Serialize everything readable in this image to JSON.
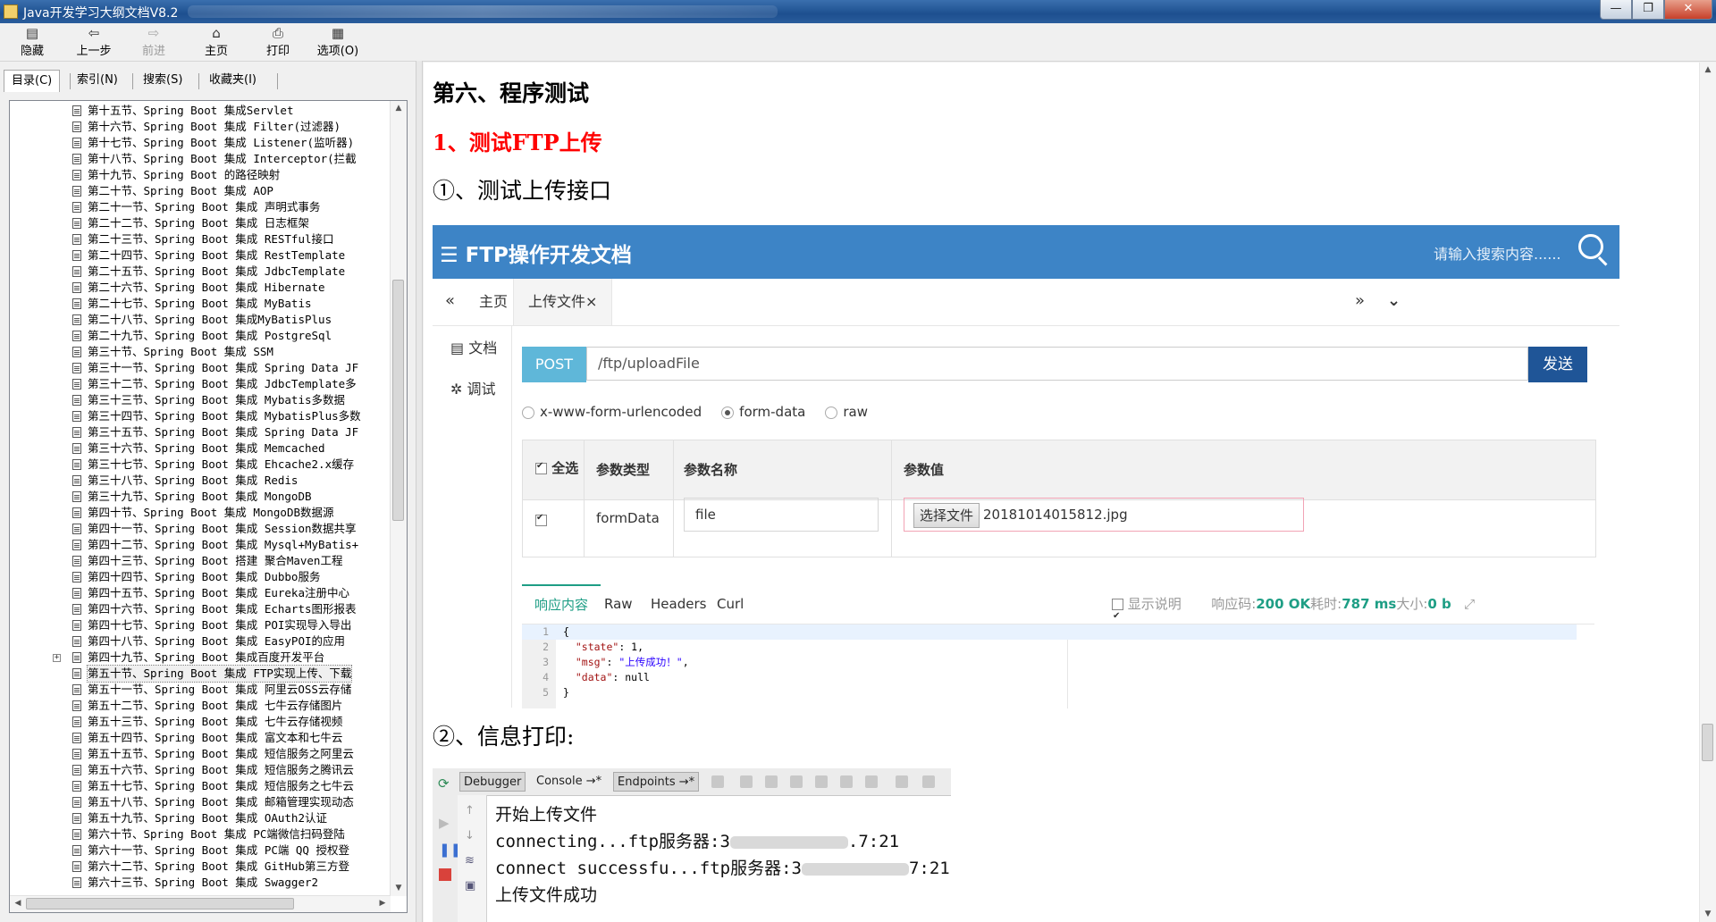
{
  "window": {
    "title": "Java开发学习大纲文档V8.2",
    "controls": {
      "min": "—",
      "max": "❐",
      "close": "✕"
    }
  },
  "toolbar": {
    "hide": "隐藏",
    "back": "上一步",
    "forward": "前进",
    "home": "主页",
    "print": "打印",
    "options": "选项(O)"
  },
  "tabs": [
    "目录(C)",
    "索引(N)",
    "搜索(S)",
    "收藏夹(I)"
  ],
  "tree": [
    "第十五节、Spring Boot 集成Servlet",
    "第十六节、Spring Boot 集成 Filter(过滤器)",
    "第十七节、Spring Boot 集成 Listener(监听器)",
    "第十八节、Spring Boot 集成 Interceptor(拦截",
    "第十九节、Spring Boot 的路径映射",
    "第二十节、Spring Boot 集成 AOP",
    "第二十一节、Spring Boot 集成 声明式事务",
    "第二十二节、Spring Boot 集成 日志框架",
    "第二十三节、Spring Boot 集成 RESTful接口",
    "第二十四节、Spring Boot 集成 RestTemplate",
    "第二十五节、Spring Boot 集成 JdbcTemplate",
    "第二十六节、Spring Boot 集成 Hibernate",
    "第二十七节、Spring Boot 集成 MyBatis",
    "第二十八节、Spring Boot 集成MyBatisPlus",
    "第二十九节、Spring Boot 集成 PostgreSql",
    "第三十节、Spring Boot 集成 SSM",
    "第三十一节、Spring Boot 集成 Spring Data JF",
    "第三十二节、Spring Boot 集成 JdbcTemplate多",
    "第三十三节、Spring Boot 集成 Mybatis多数据",
    "第三十四节、Spring Boot 集成 MybatisPlus多数",
    "第三十五节、Spring Boot 集成 Spring Data JF",
    "第三十六节、Spring Boot 集成 Memcached",
    "第三十七节、Spring Boot 集成 Ehcache2.x缓存",
    "第三十八节、Spring Boot 集成 Redis",
    "第三十九节、Spring Boot 集成 MongoDB",
    "第四十节、Spring Boot 集成 MongoDB数据源",
    "第四十一节、Spring Boot 集成 Session数据共享",
    "第四十二节、Spring Boot 集成 Mysql+MyBatis+",
    "第四十三节、Spring Boot 搭建 聚合Maven工程",
    "第四十四节、Spring Boot 集成 Dubbo服务",
    "第四十五节、Spring Boot 集成 Eureka注册中心",
    "第四十六节、Spring Boot 集成 Echarts图形报表",
    "第四十七节、Spring Boot 集成 POI实现导入导出",
    "第四十八节、Spring Boot 集成 EasyPOI的应用",
    "第四十九节、Spring Boot 集成百度开发平台",
    "第五十节、Spring Boot 集成 FTP实现上传、下载",
    "第五十一节、Spring Boot 集成 阿里云OSS云存储",
    "第五十二节、Spring Boot 集成 七牛云存储图片",
    "第五十三节、Spring Boot 集成 七牛云存储视频",
    "第五十四节、Spring Boot 集成 富文本和七牛云",
    "第五十五节、Spring Boot 集成 短信服务之阿里云",
    "第五十六节、Spring Boot 集成 短信服务之腾讯云",
    "第五十七节、Spring Boot 集成 短信服务之七牛云",
    "第五十八节、Spring Boot 集成 邮箱管理实现动态",
    "第五十九节、Spring Boot 集成 OAuth2认证",
    "第六十节、Spring Boot 集成 PC端微信扫码登陆",
    "第六十一节、Spring Boot 集成 PC端 QQ 授权登",
    "第六十二节、Spring Boot 集成 GitHub第三方登",
    "第六十三节、Spring Boot 集成 Swagger2"
  ],
  "tree_selected_index": 35,
  "content": {
    "h1": "第六、程序测试",
    "h2": "1、测试FTP上传",
    "h3": "①、测试上传接口",
    "h4": "②、信息打印:"
  },
  "ftp": {
    "brand": "☰ FTP操作开发文档",
    "search_placeholder": "请输入搜索内容......",
    "nav_prev": "«",
    "nav_next": "»",
    "nav_more": "⌄",
    "tab_home": "主页",
    "tab_upload": "上传文件×",
    "side_doc": "▤ 文档",
    "side_debug": "✲ 调试",
    "method": "POST",
    "url": "/ftp/uploadFile",
    "send": "发送",
    "radios": [
      "x-www-form-urlencoded",
      "form-data",
      "raw"
    ],
    "radio_selected": 1,
    "table_headers": [
      "全选",
      "参数类型",
      "参数名称",
      "参数值"
    ],
    "row": {
      "type": "formData",
      "name": "file",
      "file_button": "选择文件",
      "file_name": "20181014015812.jpg"
    },
    "resp_tabs": [
      "响应内容",
      "Raw",
      "Headers",
      "Curl"
    ],
    "show_desc": "显示说明",
    "resp_code_label": "响应码:",
    "resp_code": "200 OK",
    "time_label": "耗时:",
    "time": "787 ms",
    "size_label": "大小:",
    "size": "0 b",
    "code_lines": [
      "1",
      "2",
      "3",
      "4",
      "5"
    ]
  },
  "ide": {
    "tabs": [
      "Debugger",
      "Console →*",
      "Endpoints →*"
    ],
    "lines": [
      "开始上传文件",
      "connecting...ftp服务器:3",
      "connect successfu...ftp服务器:3"
    ],
    "line2_tail": ".7:21",
    "line3_tail": "7:21",
    "line4": "上传文件成功"
  },
  "colors": {
    "ftp_header": "#3d84c6",
    "post": "#5fb7d9",
    "send": "#1f5597",
    "accent_green": "#1e9e85",
    "heading_red": "#ff0000"
  }
}
